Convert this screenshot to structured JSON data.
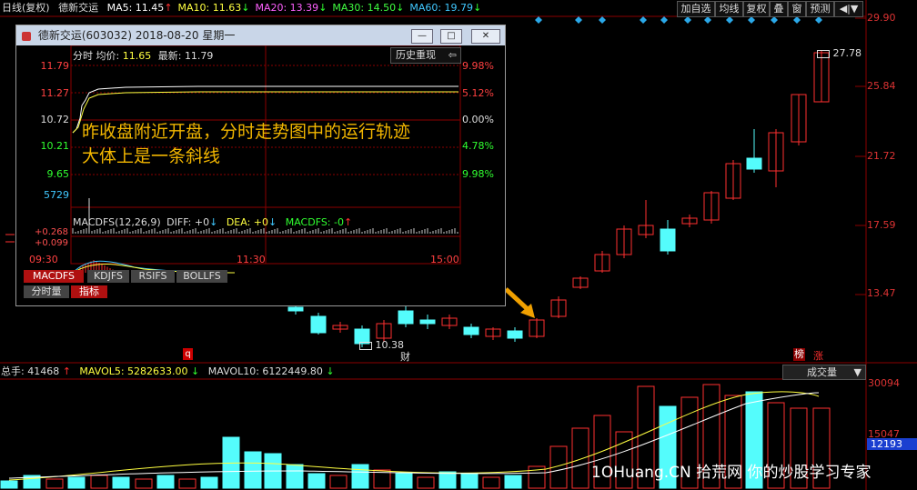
{
  "header": {
    "title": "日线(复权)",
    "stock_name": "德新交运",
    "ma_items": [
      {
        "label": "MA5: 11.45",
        "arrow": "↑",
        "color": "#ffffff",
        "arrow_color": "#ff3030"
      },
      {
        "label": "MA10: 11.63",
        "arrow": "↓",
        "color": "#ffff40",
        "arrow_color": "#30ff30"
      },
      {
        "label": "MA20: 13.39",
        "arrow": "↓",
        "color": "#ff60ff",
        "arrow_color": "#30ff30"
      },
      {
        "label": "MA30: 14.50",
        "arrow": "↓",
        "color": "#40ff40",
        "arrow_color": "#30ff30"
      },
      {
        "label": "MA60: 19.79",
        "arrow": "↓",
        "color": "#40c8ff",
        "arrow_color": "#30ff30"
      }
    ],
    "buttons": [
      "加自选",
      "均线",
      "复权",
      "叠",
      "窗",
      "预测",
      "◀|▼"
    ]
  },
  "price_axis": [
    "29.90",
    "25.84",
    "21.72",
    "17.59",
    "13.47"
  ],
  "chart_labels": {
    "high_marker": "27.78",
    "low_marker": "10.38",
    "q_tag": "q",
    "cai_tag": "财",
    "bang_tag": "榜",
    "zhang_tag": "涨"
  },
  "volume": {
    "label": "总手: 41468",
    "mavol5": "MAVOL5: 5282633.00",
    "mavol10": "MAVOL10: 6122449.80",
    "arrow_up": "↑",
    "arrow_down": "↓",
    "dropdown": "成交量",
    "axis": [
      "30094",
      "15047"
    ],
    "current": "12193"
  },
  "popup": {
    "title": "德新交运(603032)  2018-08-20  星期一",
    "min_btn": "—",
    "restore_btn": "□",
    "close_btn": "✕",
    "header_line": {
      "fenshi": "分时",
      "avg_label": "均价:",
      "avg": "11.65",
      "latest_label": "最新:",
      "latest": "11.79"
    },
    "history_btn": "历史重现",
    "left_axis": [
      "11.79",
      "11.27",
      "10.72",
      "10.21",
      "9.65",
      "5729"
    ],
    "right_axis": [
      "9.98%",
      "5.12%",
      "0.00%",
      "4.78%",
      "9.98%"
    ],
    "macd_line": {
      "name": "MACDFS(12,26,9)",
      "diff": "DIFF: +0",
      "dea": "DEA: +0",
      "macdfs": "MACDFS: -0"
    },
    "macd_axis": [
      "+0.268",
      "+0.099"
    ],
    "time_axis": [
      "09:30",
      "11:30",
      "15:00"
    ],
    "tabs": [
      "MACDFS",
      "KDJFS",
      "RSIFS",
      "BOLLFS"
    ],
    "bottom_tabs": [
      "分时量",
      "指标"
    ]
  },
  "annotation": {
    "line1": "昨收盘附近开盘，分时走势图中的运行轨迹",
    "line2": "大体上是一条斜线"
  },
  "watermark": "1OHuang.CN 拾荒网 你的炒股学习专家"
}
